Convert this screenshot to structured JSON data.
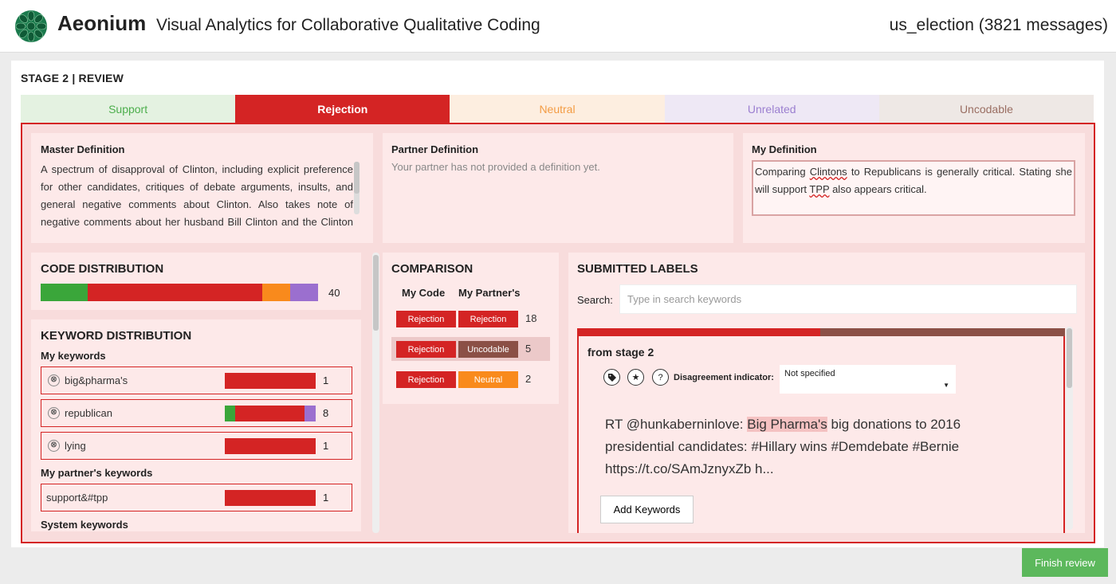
{
  "header": {
    "brand": "Aeonium",
    "tagline": "Visual Analytics for Collaborative Qualitative Coding",
    "dataset": "us_election (3821 messages)"
  },
  "stage": {
    "title": "STAGE 2 | REVIEW"
  },
  "tabs": [
    {
      "label": "Support"
    },
    {
      "label": "Rejection"
    },
    {
      "label": "Neutral"
    },
    {
      "label": "Unrelated"
    },
    {
      "label": "Uncodable"
    }
  ],
  "colors": {
    "support": "#3aa63a",
    "rejection": "#d42424",
    "neutral": "#f98a1c",
    "unrelated": "#9b6fcf",
    "uncodable": "#8b5046"
  },
  "definitions": {
    "master_title": "Master Definition",
    "master_text": "A spectrum of disapproval of Clinton, including explicit preference for other candidates, critiques of debate arguments, insults, and general negative comments about Clinton. Also takes note of negative comments about her husband Bill Clinton and the Clinton Foundation.",
    "partner_title": "Partner Definition",
    "partner_text": "Your partner has not provided a definition yet.",
    "mine_title": "My Definition",
    "mine_text_1": "Comparing ",
    "mine_text_2": "Clintons",
    "mine_text_3": " to Republicans is generally critical. Stating she will support ",
    "mine_text_4": "TPP",
    "mine_text_5": " also appears critical."
  },
  "code_distribution": {
    "title": "CODE DISTRIBUTION",
    "count": "40",
    "segments": [
      {
        "code": "support",
        "fraction": 0.17
      },
      {
        "code": "rejection",
        "fraction": 0.63
      },
      {
        "code": "neutral",
        "fraction": 0.1
      },
      {
        "code": "unrelated",
        "fraction": 0.1
      }
    ]
  },
  "keyword_distribution": {
    "title": "KEYWORD DISTRIBUTION",
    "my_label": "My keywords",
    "partner_label": "My partner's keywords",
    "system_label": "System keywords",
    "remove_icon": "⊗",
    "mine": [
      {
        "keyword": "big&pharma's",
        "count": "1"
      },
      {
        "keyword": "republican",
        "count": "8"
      },
      {
        "keyword": "lying",
        "count": "1"
      }
    ],
    "partner": [
      {
        "keyword": "support&#tpp",
        "count": "1"
      }
    ]
  },
  "comparison": {
    "title": "COMPARISON",
    "col_mine": "My Code",
    "col_partner": "My Partner's",
    "rows": [
      {
        "mine": "Rejection",
        "partner": "Rejection",
        "count": "18"
      },
      {
        "mine": "Rejection",
        "partner": "Uncodable",
        "count": "5"
      },
      {
        "mine": "Rejection",
        "partner": "Neutral",
        "count": "2"
      }
    ]
  },
  "submitted": {
    "title": "SUBMITTED LABELS",
    "search_label": "Search:",
    "search_placeholder": "Type in search keywords",
    "card": {
      "stage": "from stage 2",
      "tag_icon": "tag-icon",
      "star_icon": "star-icon",
      "help_icon": "help-icon",
      "disagreement_label": "Disagreement indicator:",
      "disagreement_value": "Not specified",
      "tweet_prefix": "RT @hunkaberninlove: ",
      "tweet_highlight": "Big Pharma's",
      "tweet_rest": " big donations to 2016 presidential candidates: #Hillary wins #Demdebate #Bernie https://t.co/SAmJznyxZb h...",
      "add_keywords": "Add Keywords"
    }
  },
  "finish_label": "Finish review"
}
